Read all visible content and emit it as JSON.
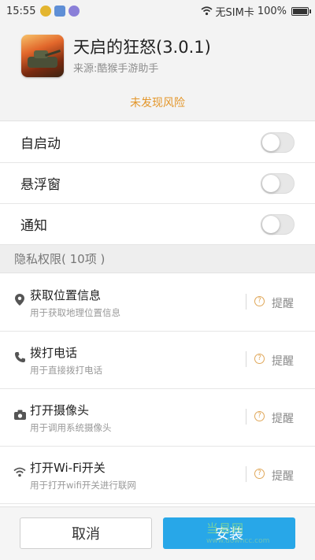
{
  "status_bar": {
    "time": "15:55",
    "carrier": "无SIM卡",
    "battery": "100%"
  },
  "app": {
    "name": "天启的狂怒(3.0.1)",
    "source": "来源:酷猴手游助手",
    "risk_status": "未发现风险",
    "risk_color": "#e3962a"
  },
  "toggles": [
    {
      "label": "自启动",
      "enabled": false
    },
    {
      "label": "悬浮窗",
      "enabled": false
    },
    {
      "label": "通知",
      "enabled": false
    }
  ],
  "privacy": {
    "header": "隐私权限( 10项 )",
    "items": [
      {
        "icon": "location-pin-icon",
        "title": "获取位置信息",
        "desc": "用于获取地理位置信息",
        "action": "提醒"
      },
      {
        "icon": "phone-icon",
        "title": "拨打电话",
        "desc": "用于直接拨打电话",
        "action": "提醒"
      },
      {
        "icon": "camera-icon",
        "title": "打开摄像头",
        "desc": "用于调用系统摄像头",
        "action": "提醒"
      },
      {
        "icon": "wifi-icon",
        "title": "打开Wi-Fi开关",
        "desc": "用于打开wifi开关进行联网",
        "action": "提醒"
      }
    ]
  },
  "buttons": {
    "cancel": "取消",
    "install": "安装"
  },
  "watermark": {
    "text": "当易网",
    "url": "www.downcc.com"
  },
  "colors": {
    "accent": "#28a7e8",
    "warning": "#e3962a"
  }
}
